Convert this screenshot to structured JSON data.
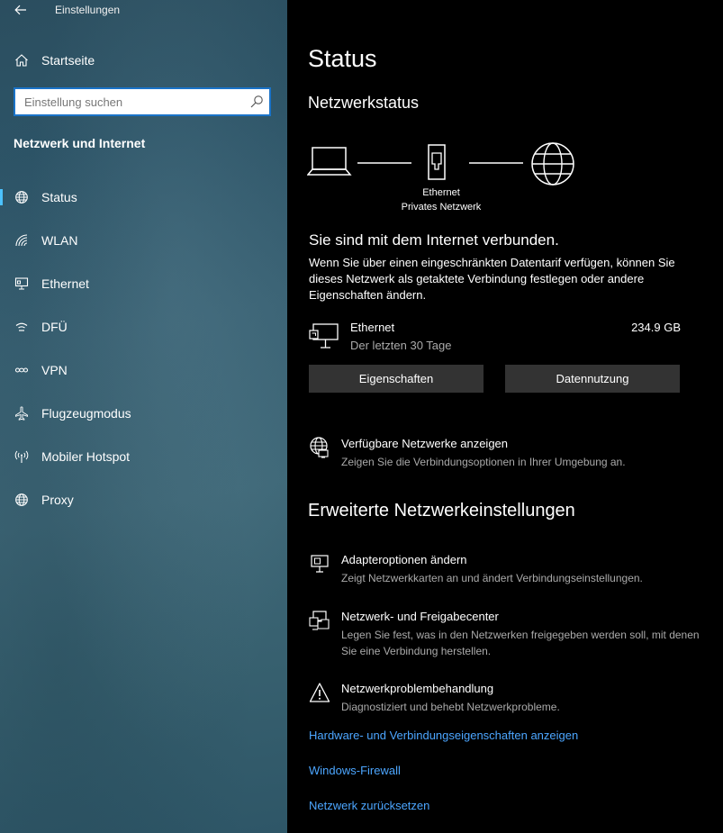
{
  "window": {
    "title": "Einstellungen"
  },
  "sidebar": {
    "home_label": "Startseite",
    "search_placeholder": "Einstellung suchen",
    "section_title": "Netzwerk und Internet",
    "items": [
      {
        "label": "Status",
        "icon": "globe-status-icon",
        "active": true
      },
      {
        "label": "WLAN",
        "icon": "wifi-icon"
      },
      {
        "label": "Ethernet",
        "icon": "ethernet-icon"
      },
      {
        "label": "DFÜ",
        "icon": "dialup-icon"
      },
      {
        "label": "VPN",
        "icon": "vpn-icon"
      },
      {
        "label": "Flugzeugmodus",
        "icon": "airplane-icon"
      },
      {
        "label": "Mobiler Hotspot",
        "icon": "hotspot-icon"
      },
      {
        "label": "Proxy",
        "icon": "globe-icon"
      }
    ]
  },
  "main": {
    "title": "Status",
    "network_status_heading": "Netzwerkstatus",
    "diagram": {
      "adapter_label": "Ethernet",
      "network_label": "Privates Netzwerk"
    },
    "connection_title": "Sie sind mit dem Internet verbunden.",
    "connection_desc": "Wenn Sie über einen eingeschränkten Datentarif verfügen, können Sie dieses Netzwerk als getaktete Verbindung festlegen oder andere Eigenschaften ändern.",
    "usage": {
      "name": "Ethernet",
      "period": "Der letzten 30 Tage",
      "amount": "234.9 GB"
    },
    "buttons": {
      "properties": "Eigenschaften",
      "data_usage": "Datennutzung"
    },
    "available_networks": {
      "title": "Verfügbare Netzwerke anzeigen",
      "desc": "Zeigen Sie die Verbindungsoptionen in Ihrer Umgebung an."
    },
    "advanced_heading": "Erweiterte Netzwerkeinstellungen",
    "advanced_items": [
      {
        "title": "Adapteroptionen ändern",
        "desc": "Zeigt Netzwerkkarten an und ändert Verbindungseinstellungen."
      },
      {
        "title": "Netzwerk- und Freigabecenter",
        "desc": "Legen Sie fest, was in den Netzwerken freigegeben werden soll, mit denen Sie eine Verbindung herstellen."
      },
      {
        "title": "Netzwerkproblembehandlung",
        "desc": "Diagnostiziert und behebt Netzwerkprobleme."
      }
    ],
    "links": [
      "Hardware- und Verbindungseigenschaften anzeigen",
      "Windows-Firewall",
      "Netzwerk zurücksetzen"
    ]
  },
  "colors": {
    "accent": "#4cc2ff",
    "link": "#4ca6ff",
    "search_border": "#1a73c8",
    "button_bg": "#333333"
  }
}
